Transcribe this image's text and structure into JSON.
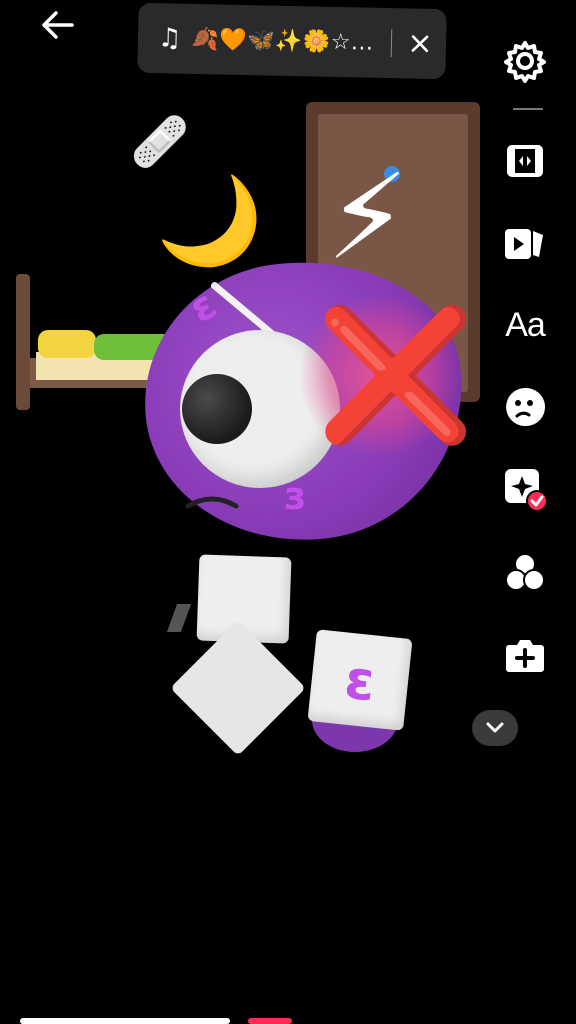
{
  "header": {
    "back_icon": "arrow-left-icon",
    "music": {
      "note_icon": "music-note-icon",
      "title": "🍂🧡🦋✨🌼☆...",
      "close_icon": "close-icon"
    }
  },
  "toolbar": {
    "items": [
      {
        "icon": "settings-gear-icon"
      },
      {
        "icon": "flip-camera-icon"
      },
      {
        "icon": "templates-icon"
      },
      {
        "icon": "text-icon",
        "label": "Aa"
      },
      {
        "icon": "sticker-icon"
      },
      {
        "icon": "effects-icon"
      },
      {
        "icon": "filters-icon"
      },
      {
        "icon": "add-clip-icon"
      }
    ],
    "more_icon": "chevron-down-icon"
  },
  "scene": {
    "stickers": [
      "🩹",
      "🌙",
      "⚡",
      "❌"
    ],
    "glyph": "ε",
    "glyph2": "з"
  },
  "colors": {
    "background": "#000000",
    "blob": "#8a3cb8",
    "accent_red": "#fe2c55",
    "pill": "#2a2a2c"
  }
}
